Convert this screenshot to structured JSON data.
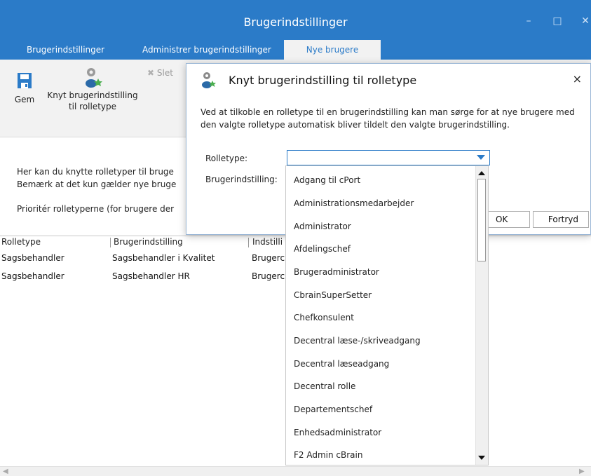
{
  "window": {
    "title": "Brugerindstillinger"
  },
  "tabs": [
    {
      "label": "Brugerindstillinger"
    },
    {
      "label": "Administrer brugerindstillinger"
    },
    {
      "label": "Nye brugere"
    }
  ],
  "ribbon": {
    "save_label": "Gem",
    "link_label_line1": "Knyt brugerindstilling",
    "link_label_line2": "til rolletype",
    "delete_label": "Slet"
  },
  "info": {
    "line1": "Her kan du knytte rolletyper til bruge",
    "line2": "Bemærk at det kun gælder nye bruge",
    "line3": "Prioritér rolletyperne (for brugere der"
  },
  "table": {
    "headers": [
      "Rolletype",
      "Brugerindstilling",
      "Indstilli"
    ],
    "rows": [
      [
        "Sagsbehandler",
        "Sagsbehandler i Kvalitet",
        "Brugerc"
      ],
      [
        "Sagsbehandler",
        "Sagsbehandler HR",
        "Brugerc"
      ]
    ]
  },
  "dialog": {
    "title": "Knyt brugerindstilling til rolletype",
    "description_line1": "Ved at tilkoble en rolletype til en brugerindstilling kan man sørge for at nye brugere med",
    "description_line2": "den valgte rolletype automatisk bliver tildelt den valgte brugerindstilling.",
    "role_label": "Rolletype:",
    "setting_label": "Brugerindstilling:",
    "role_value": "",
    "ok_label": "OK",
    "cancel_label": "Fortryd",
    "close_symbol": "×"
  },
  "dropdown": {
    "options": [
      "Adgang til cPort",
      "Administrationsmedarbejder",
      "Administrator",
      "Afdelingschef",
      "Brugeradministrator",
      "CbrainSuperSetter",
      "Chefkonsulent",
      "Decentral læse-/skriveadgang",
      "Decentral læseadgang",
      "Decentral rolle",
      "Departementschef",
      "Enhedsadministrator",
      "F2 Admin cBrain"
    ]
  },
  "colors": {
    "accent": "#2b7bc8",
    "ribbon_bg": "#f2f2f2"
  },
  "icons": [
    "save-icon",
    "gear-user-icon",
    "delete-icon",
    "close-icon",
    "dropdown-caret-icon"
  ]
}
